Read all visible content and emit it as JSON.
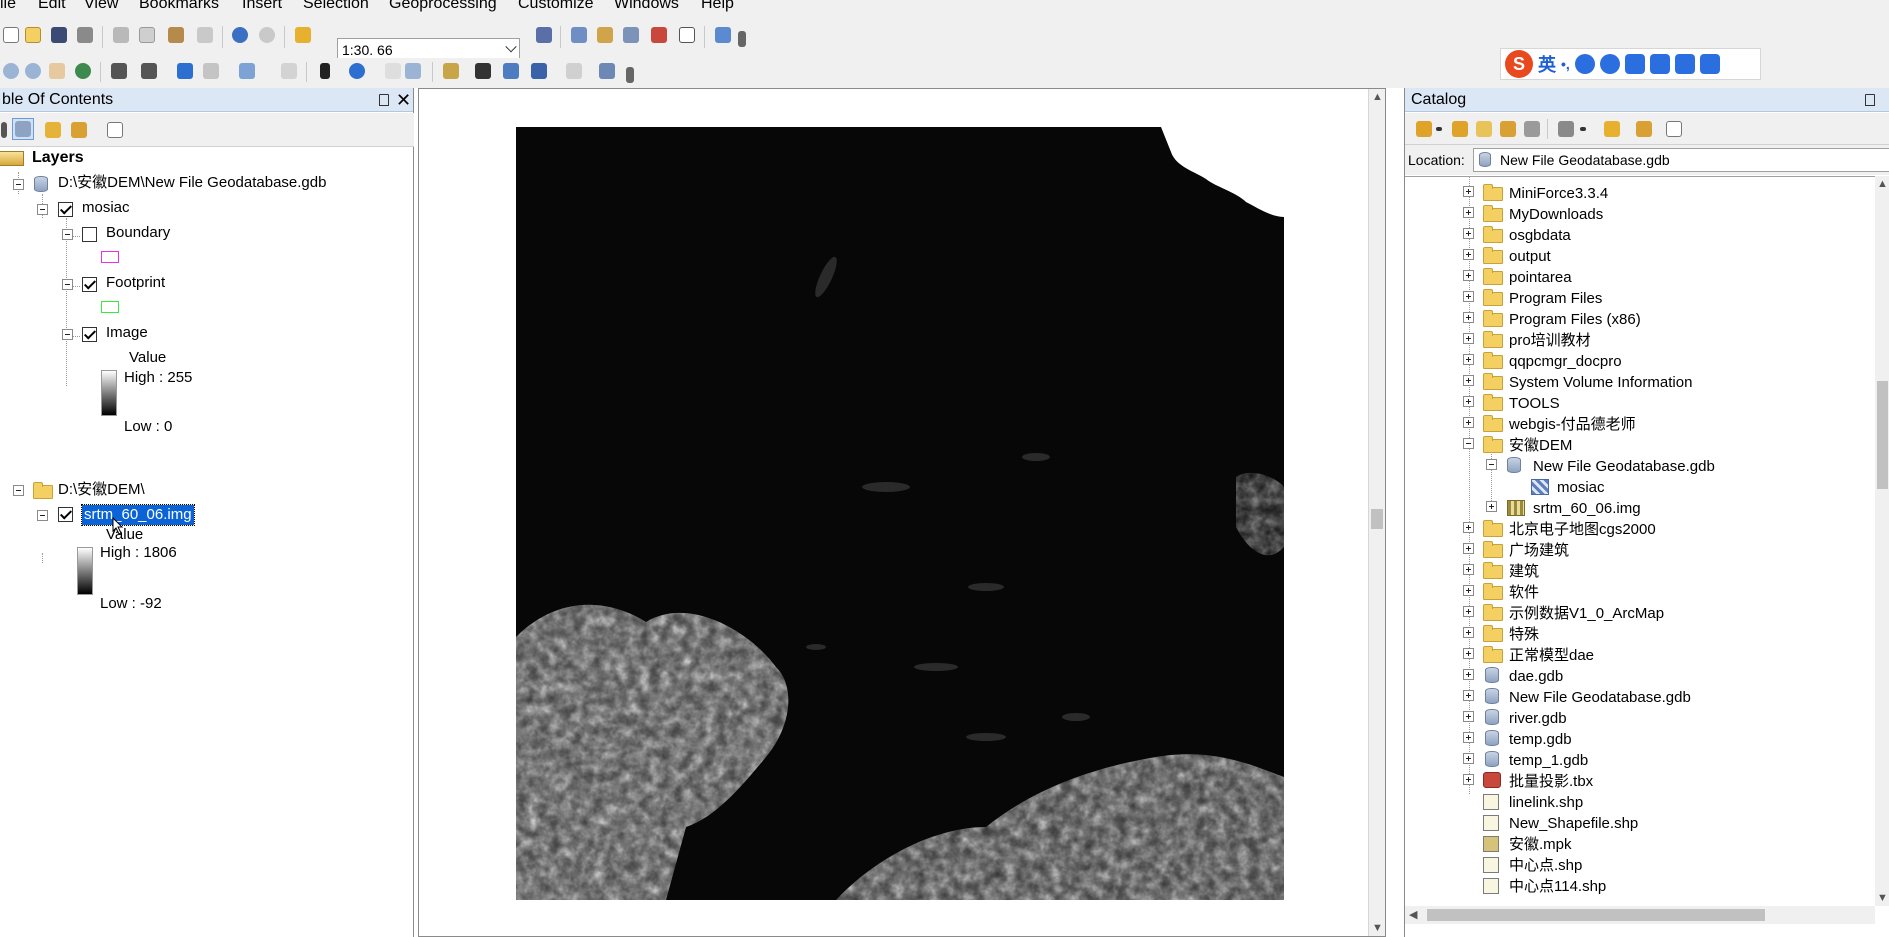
{
  "menu": [
    "ile",
    "Edit",
    "View",
    "Bookmarks",
    "Insert",
    "Selection",
    "Geoprocessing",
    "Customize",
    "Windows",
    "Help"
  ],
  "toolbar": {
    "scale": "1:30. 66"
  },
  "ime": {
    "logo": "S",
    "lang": "英"
  },
  "toc": {
    "title": "ble Of Contents",
    "root": "Layers",
    "groups": [
      {
        "path": "D:\\安徽DEM\\New File Geodatabase.gdb",
        "layer": "mosiac",
        "sublayers": [
          "Boundary",
          "Footprint",
          "Image"
        ],
        "legend": {
          "field": "Value",
          "high": "High : 255",
          "low": "Low : 0"
        }
      },
      {
        "path": "D:\\安徽DEM\\",
        "layer": "srtm_60_06.img",
        "legend": {
          "field": "Value",
          "high": "High : 1806",
          "low": "Low : -92"
        }
      }
    ]
  },
  "catalog": {
    "title": "Catalog",
    "location_label": "Location:",
    "location_value": "New File Geodatabase.gdb",
    "items": [
      "MiniForce3.3.4",
      "MyDownloads",
      "osgbdata",
      "output",
      "pointarea",
      "Program Files",
      "Program Files (x86)",
      "pro培训教材",
      "qqpcmgr_docpro",
      "System Volume Information",
      "TOOLS",
      "webgis-付品德老师",
      "安徽DEM",
      "New File Geodatabase.gdb",
      "mosiac",
      "srtm_60_06.img",
      "北京电子地图cgs2000",
      "广场建筑",
      "建筑",
      "软件",
      "示例数据V1_0_ArcMap",
      "特殊",
      "正常模型dae",
      "dae.gdb",
      "New File Geodatabase.gdb",
      "river.gdb",
      "temp.gdb",
      "temp_1.gdb",
      "批量投影.tbx",
      "linelink.shp",
      "New_Shapefile.shp",
      "安徽.mpk",
      "中心点.shp",
      "中心点114.shp"
    ]
  },
  "colors": {
    "accent": "#0a64d8",
    "panel_title": "#dbe7f5",
    "folder": "#f4cf62"
  }
}
